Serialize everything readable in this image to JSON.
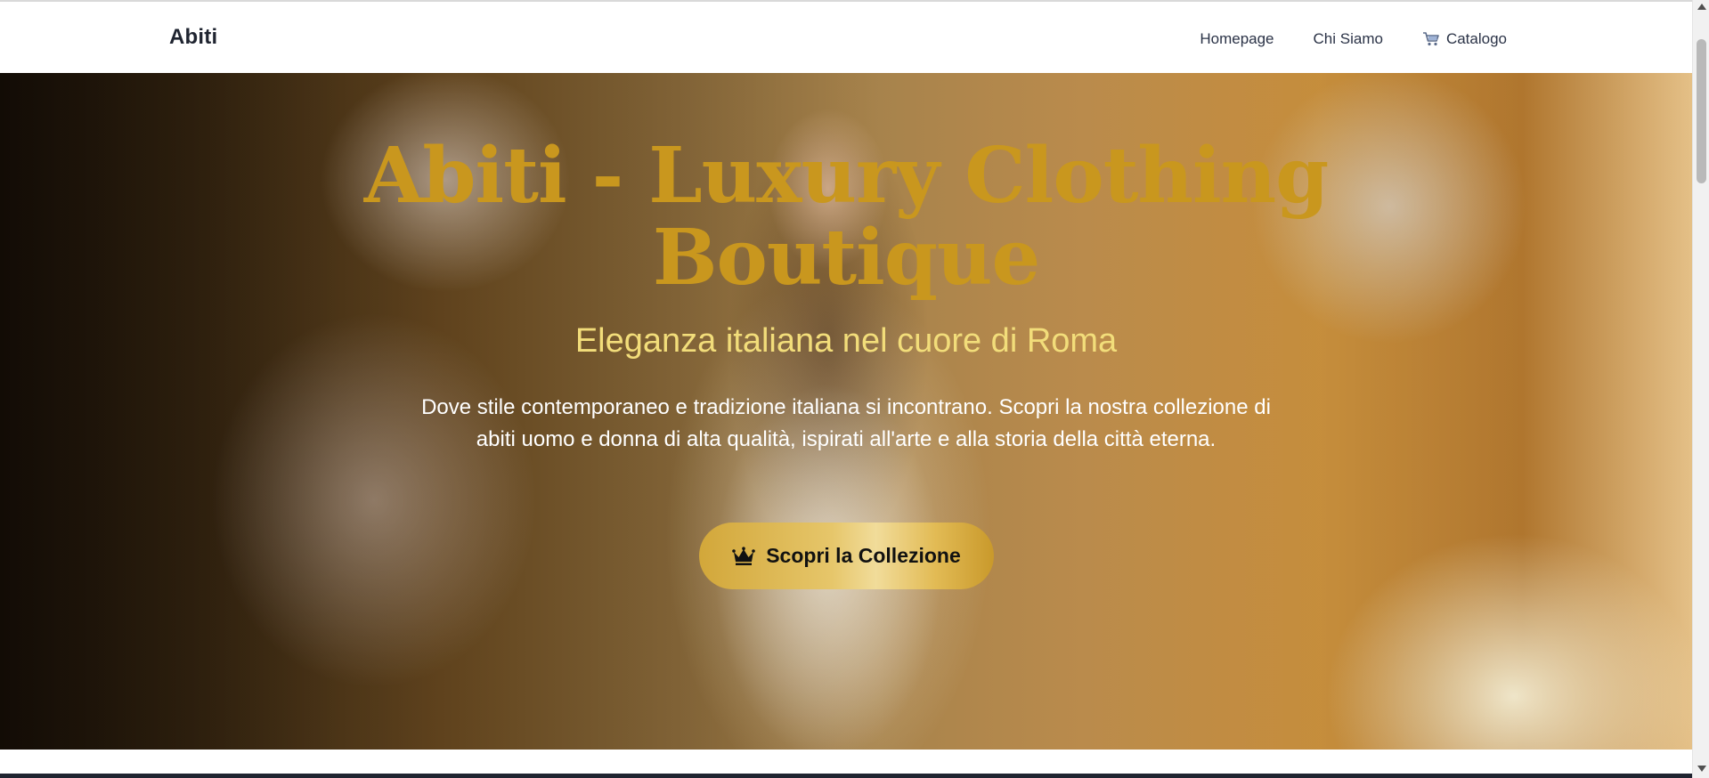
{
  "navbar": {
    "brand": "Abiti",
    "links": [
      {
        "label": "Homepage"
      },
      {
        "label": "Chi Siamo"
      },
      {
        "label": "Catalogo",
        "icon": "cart-icon"
      }
    ]
  },
  "hero": {
    "title_line1": "Abiti - Luxury Clothing",
    "title_line2": "Boutique",
    "subtitle": "Eleganza italiana nel cuore di Roma",
    "description": "Dove stile contemporaneo e tradizione italiana si incontrano. Scopri la nostra collezione di abiti uomo e donna di alta qualità, ispirati all'arte e alla storia della città eterna.",
    "cta_label": "Scopri la Collezione",
    "cta_icon": "crown-icon",
    "background_image": "woman-in-white-dress-with-flowers-photo"
  },
  "colors": {
    "title": "#c9971e",
    "subtitle": "#f2dd7a",
    "button_gold": "#e6c66a",
    "nav_text": "#2b3347"
  }
}
